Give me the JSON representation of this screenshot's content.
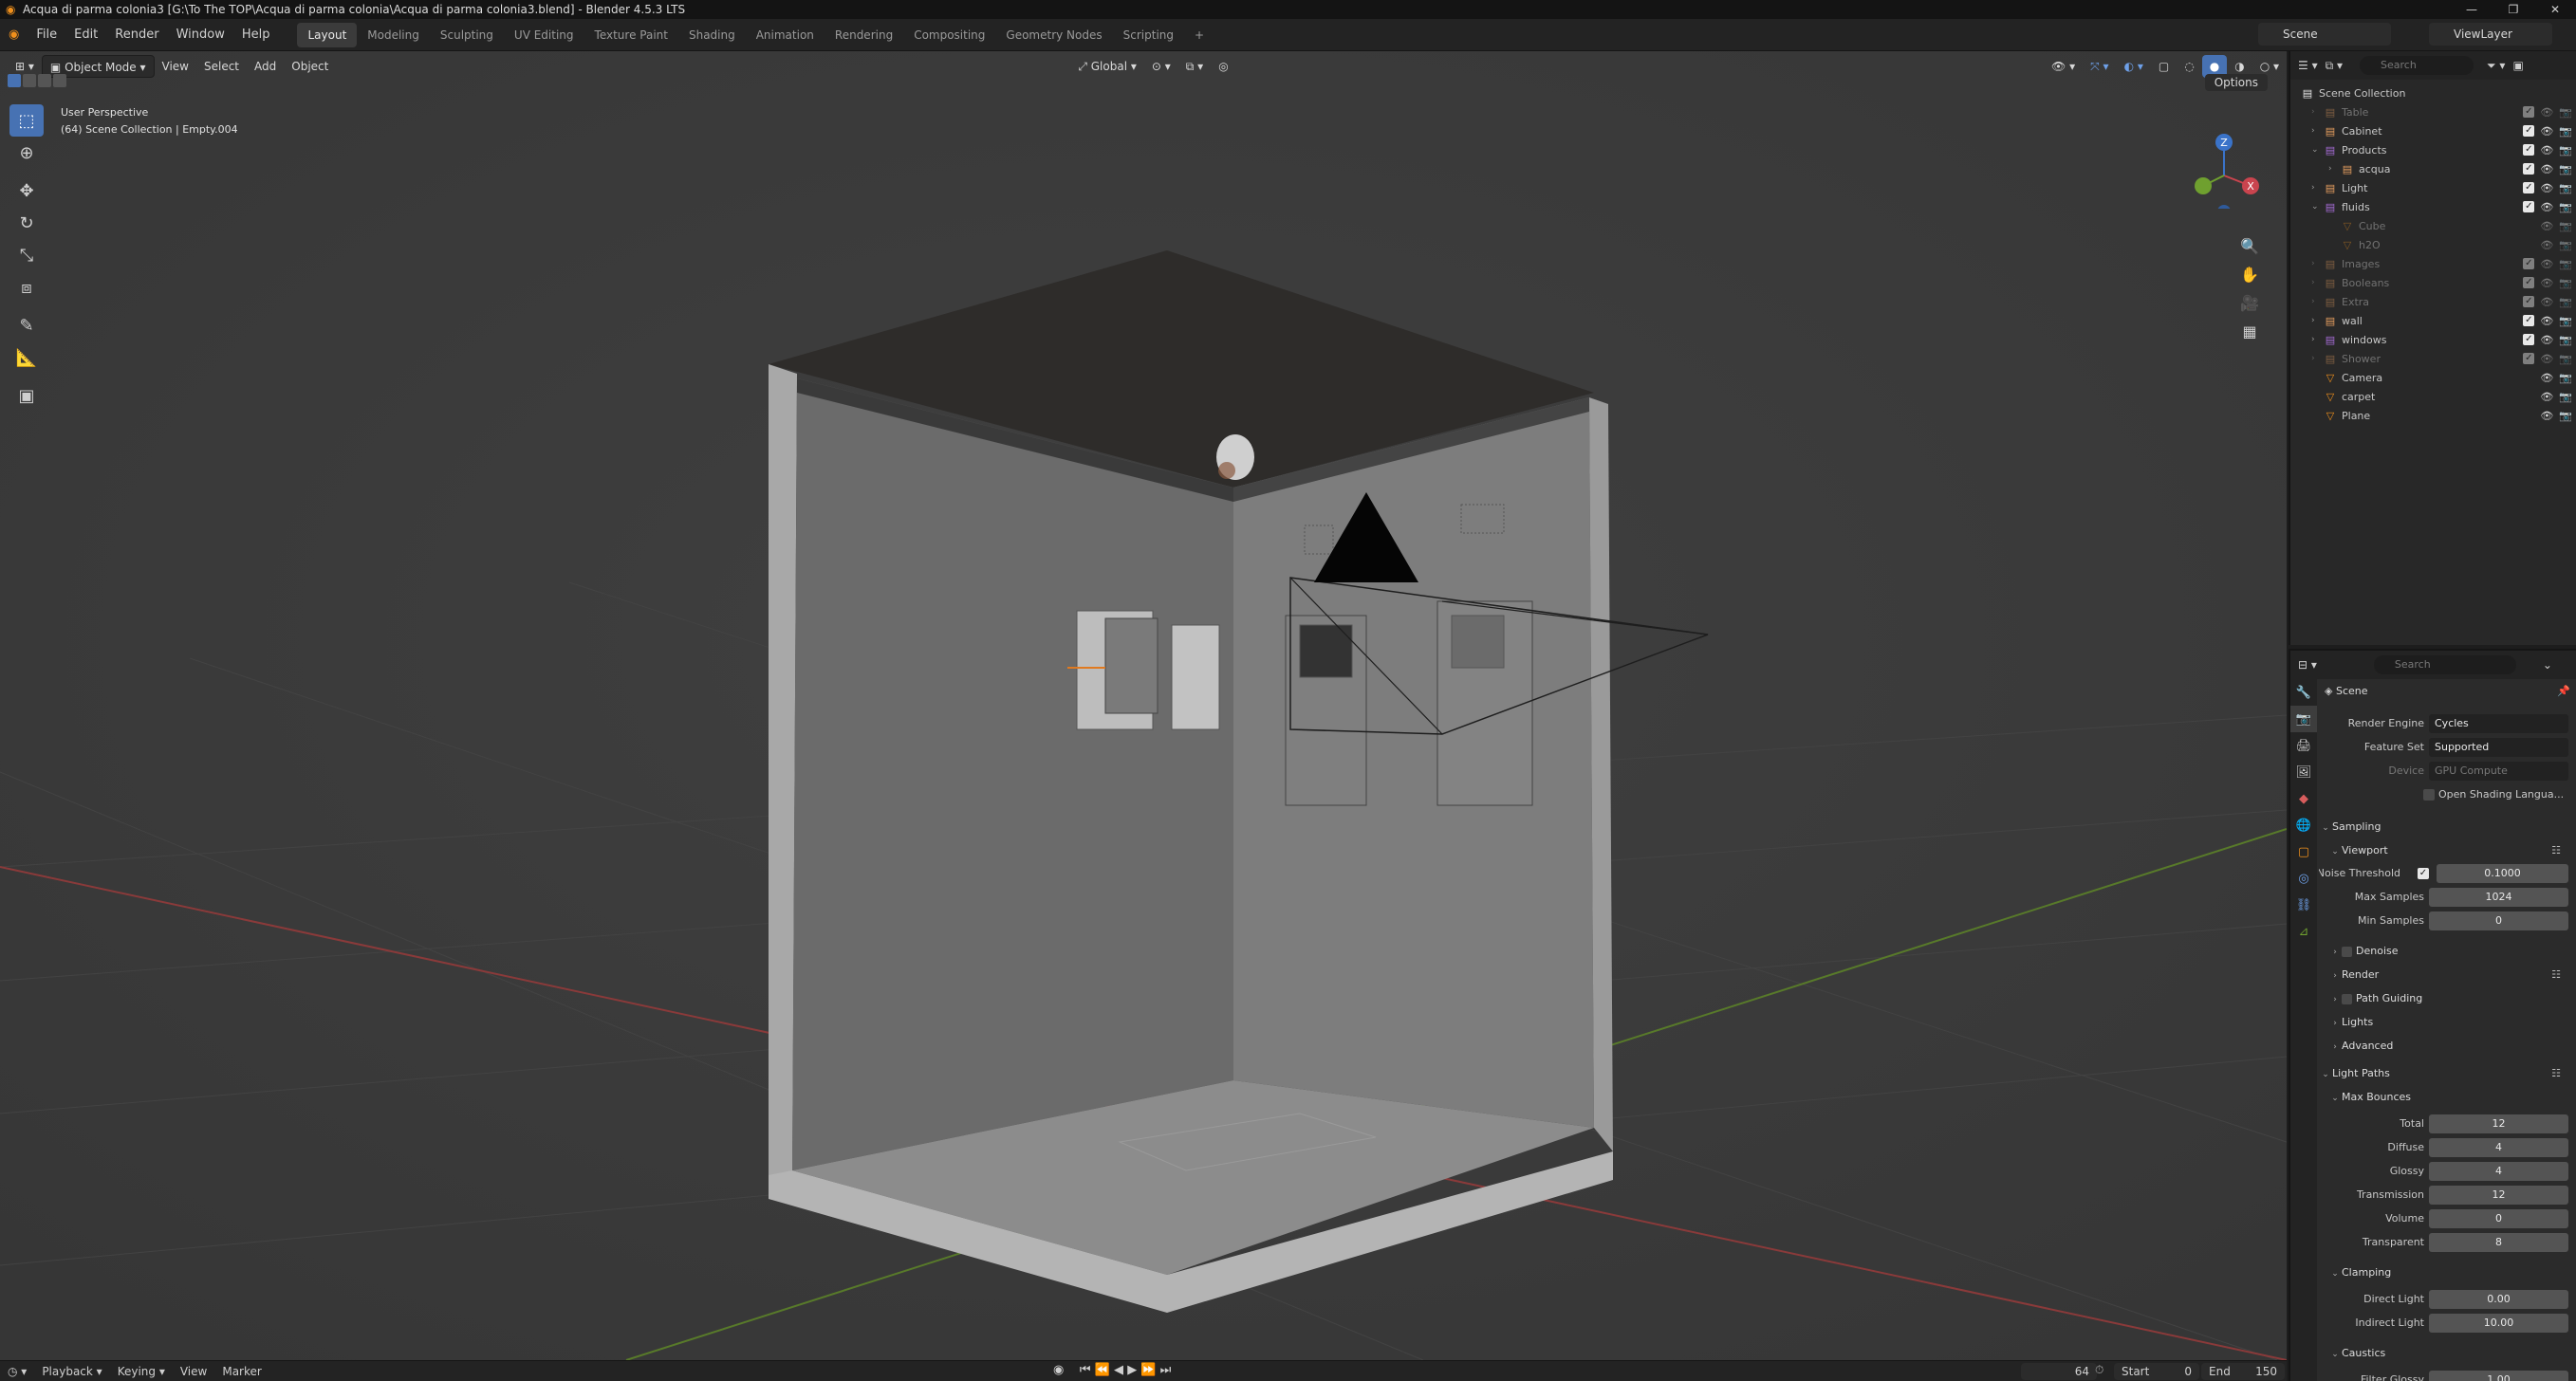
{
  "window": {
    "title": "Acqua di parma colonia3 [G:\\To The TOP\\Acqua di parma colonia\\Acqua di parma colonia3.blend] - Blender 4.5.3 LTS",
    "minimize": "—",
    "maximize": "❐",
    "close": "✕"
  },
  "menu": [
    "File",
    "Edit",
    "Render",
    "Window",
    "Help"
  ],
  "workspaces": [
    "Layout",
    "Modeling",
    "Sculpting",
    "UV Editing",
    "Texture Paint",
    "Shading",
    "Animation",
    "Rendering",
    "Compositing",
    "Geometry Nodes",
    "Scripting"
  ],
  "workspace_add": "+",
  "scene_name": "Scene",
  "view_layer": "ViewLayer",
  "viewport": {
    "mode": "Object Mode",
    "menus": [
      "View",
      "Select",
      "Add",
      "Object"
    ],
    "orientation": "Global",
    "options": "Options",
    "info_line1": "User Perspective",
    "info_line2": "(64) Scene Collection | Empty.004",
    "gizmo_axes": [
      "X",
      "Y",
      "Z"
    ]
  },
  "timeline": {
    "menus": [
      "Playback",
      "Keying",
      "View",
      "Marker"
    ],
    "current_frame": "64",
    "start_label": "Start",
    "start": "0",
    "end_label": "End",
    "end": "150"
  },
  "outliner": {
    "search_placeholder": "Search",
    "root": "Scene Collection",
    "items": [
      {
        "name": "Table",
        "icon": "collection",
        "dim": true,
        "checked": true
      },
      {
        "name": "Cabinet",
        "icon": "collection",
        "dim": false,
        "checked": true
      },
      {
        "name": "Products",
        "icon": "collection",
        "dim": false,
        "checked": true
      },
      {
        "name": "acqua",
        "icon": "collection",
        "dim": false,
        "checked": true
      },
      {
        "name": "Light",
        "icon": "collection",
        "dim": false,
        "checked": true
      },
      {
        "name": "fluids",
        "icon": "collection",
        "dim": false,
        "checked": true
      },
      {
        "name": "Cube",
        "icon": "mesh",
        "dim": true,
        "checked": false
      },
      {
        "name": "h2O",
        "icon": "mesh",
        "dim": true,
        "checked": false
      },
      {
        "name": "Images",
        "icon": "collection",
        "dim": true,
        "checked": true
      },
      {
        "name": "Booleans",
        "icon": "collection",
        "dim": true,
        "checked": true
      },
      {
        "name": "Extra",
        "icon": "collection",
        "dim": true,
        "checked": true
      },
      {
        "name": "wall",
        "icon": "collection",
        "dim": false,
        "checked": true
      },
      {
        "name": "windows",
        "icon": "collection",
        "dim": false,
        "checked": true
      },
      {
        "name": "Shower",
        "icon": "collection",
        "dim": true,
        "checked": true
      },
      {
        "name": "Camera",
        "icon": "mesh",
        "dim": false,
        "checked": false
      },
      {
        "name": "carpet",
        "icon": "mesh",
        "dim": false,
        "checked": false
      },
      {
        "name": "Plane",
        "icon": "mesh",
        "dim": false,
        "checked": false
      }
    ]
  },
  "properties": {
    "search_placeholder": "Search",
    "context": "Scene",
    "render_engine_label": "Render Engine",
    "render_engine": "Cycles",
    "feature_set_label": "Feature Set",
    "feature_set": "Supported",
    "device_label": "Device",
    "device": "GPU Compute",
    "osl_label": "Open Shading Langua...",
    "sampling": "Sampling",
    "viewport": "Viewport",
    "noise_threshold_label": "Noise Threshold",
    "noise_threshold": "0.1000",
    "max_samples_label": "Max Samples",
    "max_samples": "1024",
    "min_samples_label": "Min Samples",
    "min_samples": "0",
    "denoise": "Denoise",
    "render": "Render",
    "path_guiding": "Path Guiding",
    "lights": "Lights",
    "advanced": "Advanced",
    "light_paths": "Light Paths",
    "max_bounces": "Max Bounces",
    "total_label": "Total",
    "total": "12",
    "diffuse_label": "Diffuse",
    "diffuse": "4",
    "glossy_label": "Glossy",
    "glossy": "4",
    "transmission_label": "Transmission",
    "transmission": "12",
    "volume_label": "Volume",
    "volume": "0",
    "transparent_label": "Transparent",
    "transparent": "8",
    "clamping": "Clamping",
    "direct_light_label": "Direct Light",
    "direct_light": "0.00",
    "indirect_light_label": "Indirect Light",
    "indirect_light": "10.00",
    "caustics": "Caustics",
    "filter_glossy_label": "Filter Glossy",
    "filter_glossy": "1.00"
  },
  "colors": {
    "accent": "#4772b3",
    "collection_icon": "#e8e8e8",
    "mesh_icon": "#f0901c",
    "x_axis": "#c9444e",
    "y_axis": "#6fa02f",
    "z_axis": "#3a73c9"
  }
}
